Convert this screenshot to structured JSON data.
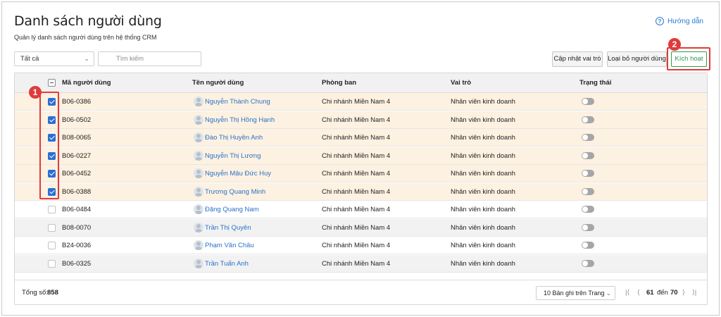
{
  "header": {
    "title": "Danh sách người dùng",
    "subtitle": "Quản lý danh sách người dùng trên hệ thống CRM",
    "help_label": "Hướng dẫn"
  },
  "filter": {
    "selected": "Tất cả",
    "search_placeholder": "Tìm kiếm"
  },
  "toolbar": {
    "update_role_label": "Cập nhật vai trò",
    "remove_user_label": "Loại bỏ người dùng",
    "activate_label": "Kích hoạt"
  },
  "callouts": {
    "badge1": "1",
    "badge2": "2"
  },
  "table": {
    "columns": [
      "Mã người dùng",
      "Tên người dùng",
      "Phòng ban",
      "Vai trò",
      "Trạng thái"
    ],
    "rows": [
      {
        "code": "B06-0386",
        "name": "Nguyễn Thành Chung",
        "dept": "Chi nhánh Miền Nam 4",
        "role": "Nhân viên kinh doanh",
        "checked": true,
        "active": false
      },
      {
        "code": "B06-0502",
        "name": "Nguyễn Thị Hồng Hạnh",
        "dept": "Chi nhánh Miền Nam 4",
        "role": "Nhân viên kinh doanh",
        "checked": true,
        "active": false
      },
      {
        "code": "B08-0065",
        "name": "Đào Thị Huyền Anh",
        "dept": "Chi nhánh Miền Nam 4",
        "role": "Nhân viên kinh doanh",
        "checked": true,
        "active": false
      },
      {
        "code": "B06-0227",
        "name": "Nguyễn Thị Lương",
        "dept": "Chi nhánh Miền Nam 4",
        "role": "Nhân viên kinh doanh",
        "checked": true,
        "active": false
      },
      {
        "code": "B06-0452",
        "name": "Nguyễn Mậu Đức Huy",
        "dept": "Chi nhánh Miền Nam 4",
        "role": "Nhân viên kinh doanh",
        "checked": true,
        "active": false
      },
      {
        "code": "B06-0388",
        "name": "Trương Quang Minh",
        "dept": "Chi nhánh Miền Nam 4",
        "role": "Nhân viên kinh doanh",
        "checked": true,
        "active": false
      },
      {
        "code": "B06-0484",
        "name": "Đặng Quang Nam",
        "dept": "Chi nhánh Miền Nam 4",
        "role": "Nhân viên kinh doanh",
        "checked": false,
        "active": false
      },
      {
        "code": "B08-0070",
        "name": "Trần Thị Quyên",
        "dept": "Chi nhánh Miền Nam 4",
        "role": "Nhân viên kinh doanh",
        "checked": false,
        "active": false
      },
      {
        "code": "B24-0036",
        "name": "Phạm Văn Châu",
        "dept": "Chi nhánh Miền Nam 4",
        "role": "Nhân viên kinh doanh",
        "checked": false,
        "active": false
      },
      {
        "code": "B06-0325",
        "name": "Trần Tuấn Anh",
        "dept": "Chi nhánh Miền Nam 4",
        "role": "Nhân viên kinh doanh",
        "checked": false,
        "active": false
      }
    ]
  },
  "footer": {
    "total_label": "Tổng số:",
    "total_value": "858",
    "page_size": "10 Bản ghi trên Trang",
    "range_from": "61",
    "range_to_label": "đến",
    "range_to": "70"
  },
  "colors": {
    "selected_row": "#fdf1e1",
    "checkbox_checked": "#2b6fd6",
    "link": "#2a72c8",
    "activate": "#2e9a52",
    "callout": "#e03b3b"
  }
}
